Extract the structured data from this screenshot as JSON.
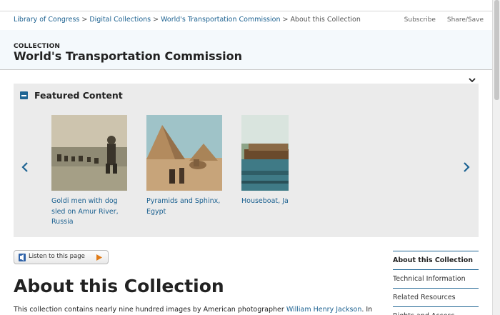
{
  "breadcrumb": {
    "items": [
      "Library of Congress",
      "Digital Collections",
      "World's Transportation Commission"
    ],
    "current": "About this Collection",
    "separator": ">"
  },
  "top_links": {
    "subscribe": "Subscribe",
    "share": "Share/Save"
  },
  "header": {
    "kicker": "COLLECTION",
    "title": "World's Transportation Commission"
  },
  "featured": {
    "heading": "Featured Content",
    "items": [
      {
        "caption": "Goldi men with dog sled on Amur River, Russia"
      },
      {
        "caption": "Pyramids and Sphinx, Egypt"
      },
      {
        "caption": "Houseboat, Ja"
      }
    ]
  },
  "listen": {
    "label": "Listen to this page"
  },
  "main": {
    "heading": "About this Collection",
    "intro_before": "This collection contains nearly nine hundred images by American photographer ",
    "intro_link": "William Henry Jackson",
    "intro_after": ". In"
  },
  "sidebar": {
    "items": [
      {
        "label": "About this Collection"
      },
      {
        "label": "Technical Information"
      },
      {
        "label": "Related Resources"
      },
      {
        "label": "Rights and Access"
      }
    ]
  },
  "colors": {
    "link": "#1d6291",
    "accent": "#1e6493",
    "hero_bg": "#f4f9fc",
    "panel_bg": "#ebebeb"
  }
}
